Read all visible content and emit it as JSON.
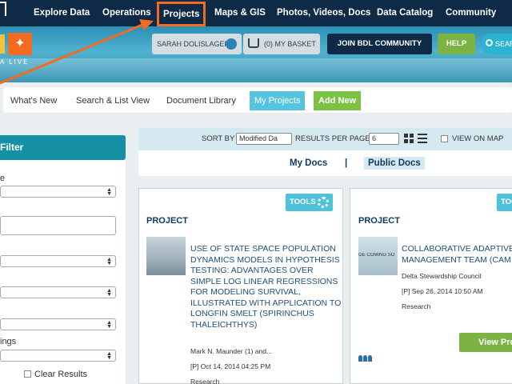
{
  "nav": {
    "items": [
      "Explore Data",
      "Operations",
      "Projects",
      "Maps & GIS",
      "Photos, Videos, Docs",
      "Data Catalog",
      "Community"
    ],
    "highlight_color": "#f26b21"
  },
  "header": {
    "logo_text": "A LIVE",
    "user_name": "SARAH DOLISLAGER",
    "basket": "(0) MY BASKET",
    "join_label": "JOIN BDL COMMUNITY",
    "help_label": "HELP",
    "search_label": "SEAR"
  },
  "tabs": [
    "What's New",
    "Search & List View",
    "Document Library",
    "My Projects",
    "Add New"
  ],
  "filter": {
    "title": "Filter",
    "labels": [
      "e",
      "ings"
    ],
    "clear_label": "Clear Results"
  },
  "sortbar": {
    "sort_by": "SORT BY",
    "sort_value": "Modified Da",
    "results_label": "RESULTS PER PAGE",
    "results_value": "6",
    "view_on_map": "VIEW ON MAP"
  },
  "docs": {
    "my_docs": "My Docs",
    "separator": "|",
    "public_docs": "Public Docs"
  },
  "cards": [
    {
      "tools": "TOOLS",
      "type": "PROJECT",
      "title": "USE OF STATE SPACE POPULATION DYNAMICS MODELS IN HYPOTHESIS TESTING: ADVANTAGES OVER SIMPLE LOG LINEAR REGRESSIONS FOR MODELING SURVIVAL, ILLUSTRATED WITH APPLICATION TO LONGFIN SMELT (SPIRINCHUS THALEICHTHYS)",
      "author": "Mark N. Maunder (1) and...",
      "date": "[P] Oct 14, 2014 04:25 PM",
      "category": "Research"
    },
    {
      "tools": "TOOLS",
      "type": "PROJECT",
      "thumb_text": "GE COMING SO",
      "title": "COLLABORATIVE ADAPTIVE MANAGEMENT TEAM (CAM",
      "author": "Delta Stewardship Council",
      "date": "[P] Sep 26, 2014 10:50 AM",
      "category": "Research",
      "view_label": "View Pro"
    }
  ]
}
